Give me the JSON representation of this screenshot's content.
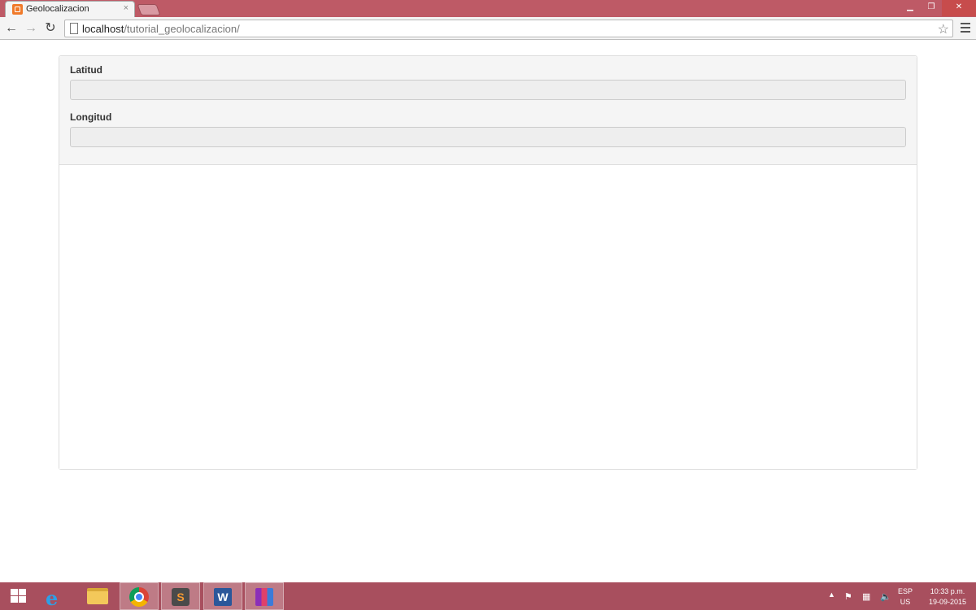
{
  "browser": {
    "tab_title": "Geolocalizacion",
    "tab_close": "×",
    "url_host": "localhost",
    "url_path": "/tutorial_geolocalizacion/"
  },
  "form": {
    "latitude_label": "Latitud",
    "latitude_value": "",
    "longitude_label": "Longitud",
    "longitude_value": ""
  },
  "taskbar": {
    "apps": [
      "internet-explorer",
      "file-explorer",
      "chrome",
      "sublime-text",
      "word",
      "winrar"
    ],
    "active_app": "chrome",
    "sublime_letter": "S",
    "word_letter": "W",
    "lang_code": "ESP",
    "lang_region": "US",
    "time": "10:33 p.m.",
    "date": "19-09-2015"
  },
  "colors": {
    "titlebar": "#be5a66",
    "taskbar": "#a84f5e",
    "panel_heading": "#f5f5f5"
  }
}
